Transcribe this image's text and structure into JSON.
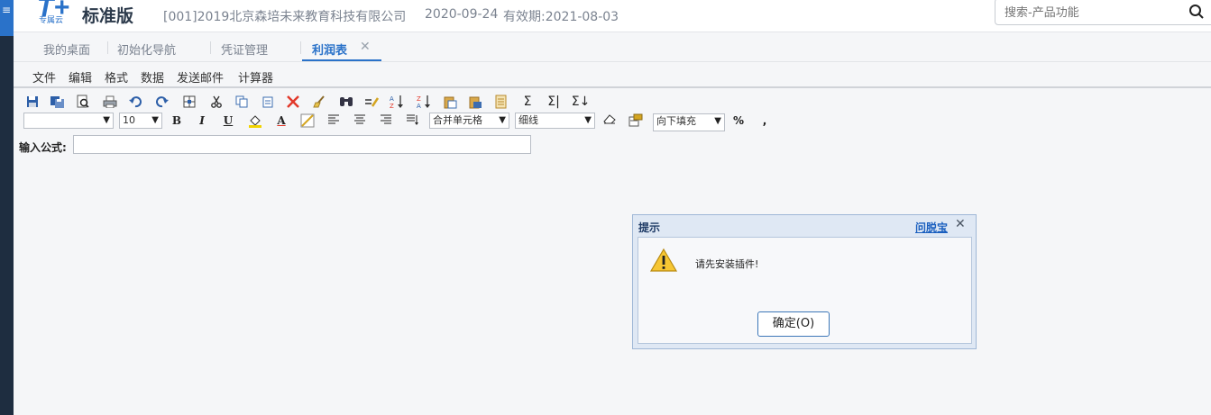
{
  "header": {
    "logo_letter": "T+",
    "logo_sub": "专属云",
    "edition": "标准版",
    "company": "[001]2019北京森培未来教育科技有限公司",
    "login_date": "2020-09-24",
    "valid_until": "有效期:2021-08-03",
    "search_placeholder": "搜索-产品功能"
  },
  "tabs": [
    {
      "label": "我的桌面"
    },
    {
      "label": "初始化导航"
    },
    {
      "label": "凭证管理"
    },
    {
      "label": "利润表"
    }
  ],
  "tab_close": "✕",
  "menu": [
    {
      "label": "文件"
    },
    {
      "label": "编辑"
    },
    {
      "label": "格式"
    },
    {
      "label": "数据"
    },
    {
      "label": "发送邮件"
    },
    {
      "label": "计算器"
    }
  ],
  "format_toolbar": {
    "font_name": "",
    "font_size": "10",
    "bold": "B",
    "italic": "I",
    "underline": "U",
    "font_color": "A",
    "merge": "合并单元格",
    "border": "细线",
    "fill": "向下填充",
    "percent": "%",
    "comma": ","
  },
  "formula": {
    "label": "输入公式:",
    "value": ""
  },
  "dialog": {
    "title": "提示",
    "help": "问脱宝",
    "close": "✕",
    "message": "请先安装插件!",
    "ok": "确定(O)"
  },
  "icons": [
    "save-icon",
    "save-as-icon",
    "print-preview-icon",
    "print-icon",
    "undo-icon",
    "redo-icon",
    "select-all-icon",
    "cut-icon",
    "copy-icon",
    "paste-icon",
    "delete-icon",
    "clear-icon",
    "find-icon",
    "replace-icon",
    "sort-asc-icon",
    "sort-desc-icon",
    "paste-value-icon",
    "paste-format-icon",
    "sheet-icon",
    "sum-icon",
    "sum-row-icon",
    "sum-col-icon"
  ],
  "colors": {
    "accent": "#2a72c9",
    "dialog_bg": "#dfe8f4"
  }
}
